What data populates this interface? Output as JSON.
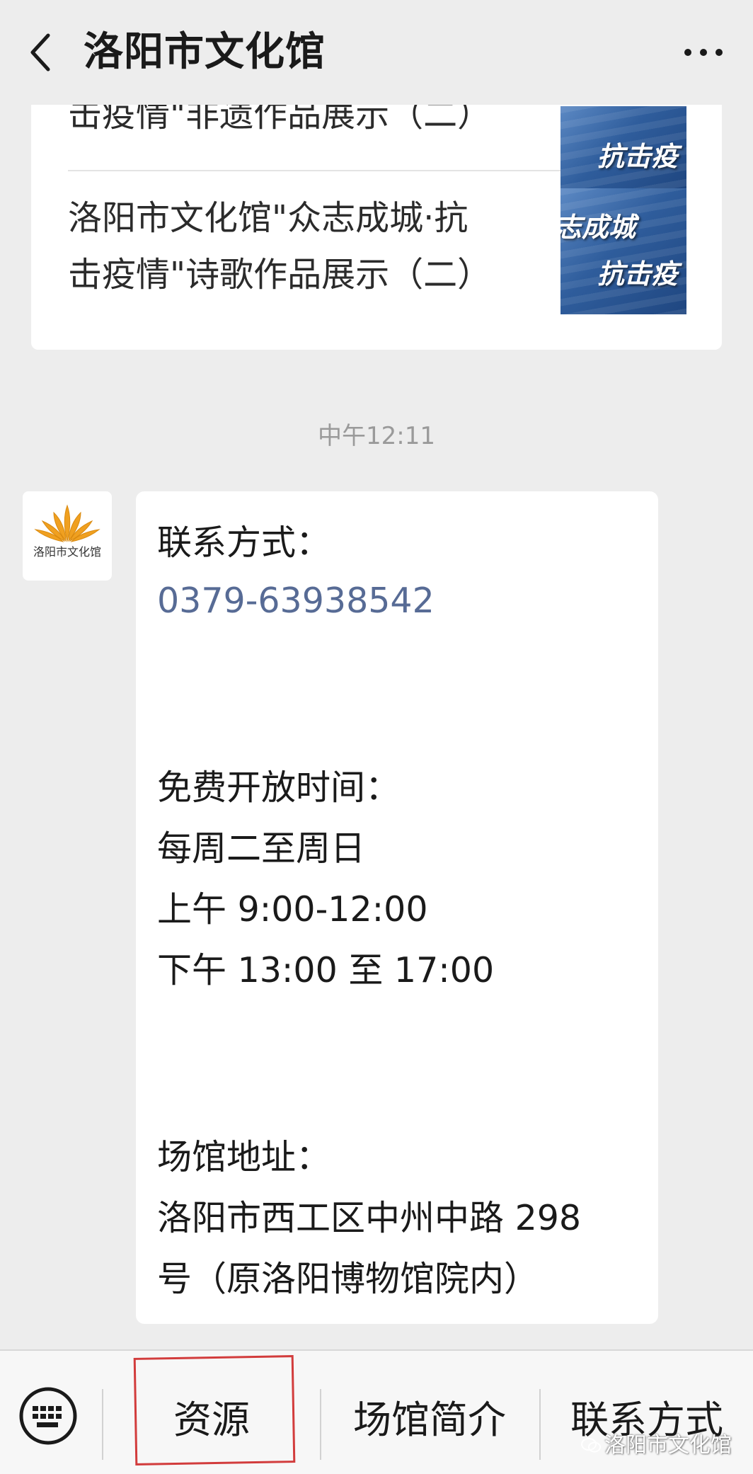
{
  "header": {
    "title": "洛阳市文化馆",
    "back_icon": "chevron-left-icon",
    "more_icon": "more-dots-icon"
  },
  "articles": [
    {
      "title_line": "击疫情\"非遗作品展示（二）",
      "thumb_text": "抗击疫"
    },
    {
      "title_line1": "洛阳市文化馆\"众志成城·抗",
      "title_line2": "击疫情\"诗歌作品展示（二）",
      "thumb_text1": "志成城",
      "thumb_text2": "抗击疫"
    }
  ],
  "timestamp": "中午12:11",
  "avatar": {
    "name_text": "洛阳市文化馆",
    "logo_color": "#f0a020"
  },
  "message": {
    "contact_label": "联系方式：",
    "phone": "0379-63938542",
    "hours_label": "免费开放时间：",
    "days": "每周二至周日",
    "morning": "上午 9:00-12:00",
    "afternoon": "下午 13:00 至 17:00",
    "address_label": "场馆地址：",
    "address_line1": "洛阳市西工区中州中路 298",
    "address_line2": "号（原洛阳博物馆院内）"
  },
  "bottom_menu": {
    "keyboard_icon": "keyboard-icon",
    "items": [
      "资源",
      "场馆简介",
      "联系方式"
    ]
  },
  "watermark": "洛阳市文化馆",
  "colors": {
    "background": "#ededed",
    "link": "#576b95",
    "highlight": "#d23c3c"
  }
}
